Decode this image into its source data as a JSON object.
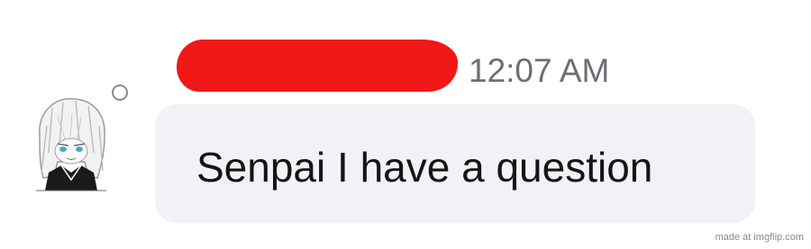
{
  "message": {
    "sender_name": "",
    "timestamp": "12:07 AM",
    "text": "Senpai I have a question"
  },
  "avatar": {
    "icon": "anime-girl-avatar",
    "presence": "offline-ring"
  },
  "redaction_color": "#f01818",
  "bubble_color": "#f1f1f6",
  "watermark": "made at imgflip.com"
}
